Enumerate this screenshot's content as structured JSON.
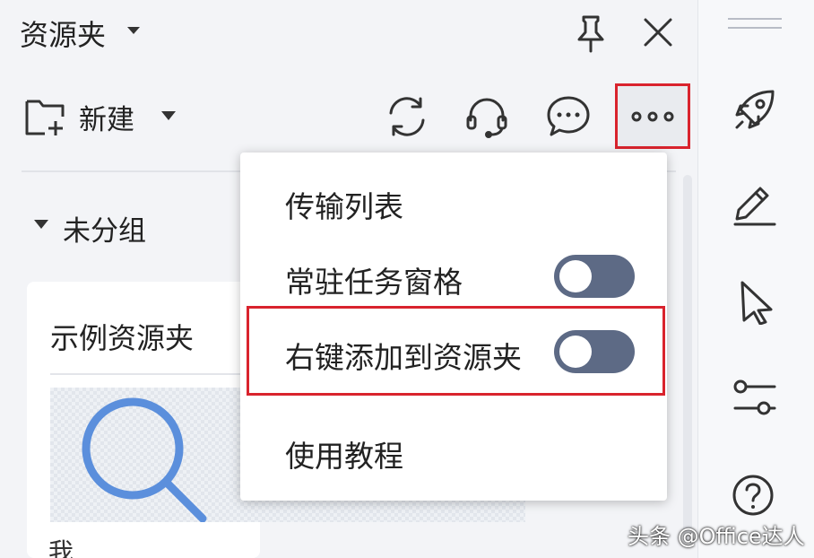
{
  "panel": {
    "title": "资源夹",
    "new_label": "新建",
    "group_label": "未分组"
  },
  "card": {
    "title": "示例资源夹",
    "bottom_text": "我"
  },
  "menu": {
    "items": [
      {
        "label": "传输列表"
      },
      {
        "label": "常驻任务窗格",
        "toggle": "off"
      },
      {
        "label": "右键添加到资源夹",
        "toggle": "off"
      },
      {
        "label": "使用教程"
      }
    ]
  },
  "icons": {
    "title_bar": [
      "pin-icon",
      "close-icon"
    ],
    "toolbar": [
      "new-folder-icon",
      "refresh-icon",
      "headset-icon",
      "chat-icon",
      "more-icon"
    ],
    "sidebar": [
      "rocket-icon",
      "pen-icon",
      "cursor-icon",
      "sliders-icon",
      "help-icon"
    ]
  },
  "colors": {
    "highlight": "#d9232d",
    "toggle_off": "#5d6a85",
    "thumbnail_accent": "#5b8fdc"
  },
  "watermark": "头条 @Office达人"
}
